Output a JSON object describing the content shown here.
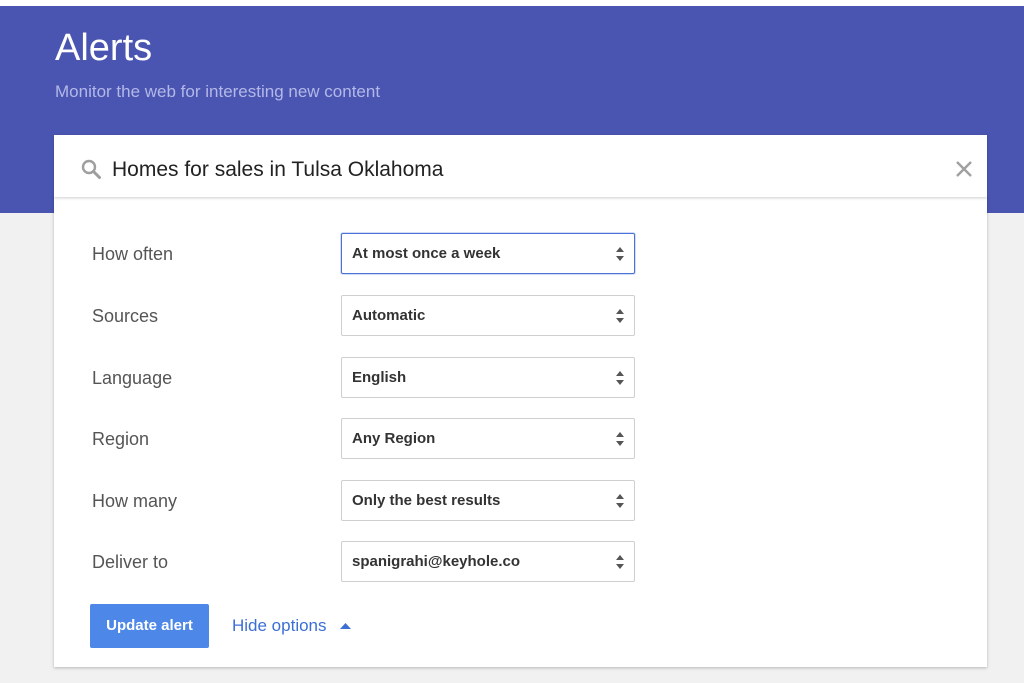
{
  "header": {
    "title": "Alerts",
    "subtitle": "Monitor the web for interesting new content",
    "background_color": "#4a55b1"
  },
  "search": {
    "query": "Homes for sales in Tulsa Oklahoma",
    "search_icon": "search-icon",
    "clear_icon": "close-icon"
  },
  "options": {
    "how_often": {
      "label": "How often",
      "value": "At most once a week"
    },
    "sources": {
      "label": "Sources",
      "value": "Automatic"
    },
    "language": {
      "label": "Language",
      "value": "English"
    },
    "region": {
      "label": "Region",
      "value": "Any Region"
    },
    "how_many": {
      "label": "How many",
      "value": "Only the best results"
    },
    "deliver_to": {
      "label": "Deliver to",
      "value": "spanigrahi@keyhole.co"
    }
  },
  "actions": {
    "update_label": "Update alert",
    "hide_options_label": "Hide options",
    "button_color": "#4d88e8",
    "link_color": "#3b6fd6"
  }
}
